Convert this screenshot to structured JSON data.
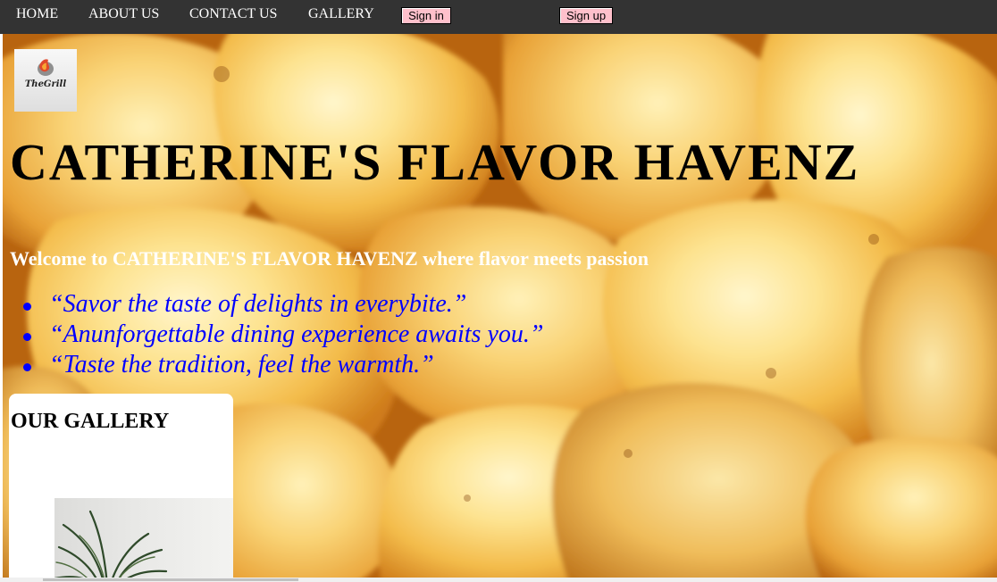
{
  "nav": {
    "links": [
      "HOME",
      "ABOUT US",
      "CONTACT US",
      "GALLERY"
    ],
    "signin_label": "Sign in",
    "signup_label": "Sign up"
  },
  "hero": {
    "title": "CATHERINE'S FLAVOR HAVENZ",
    "welcome": "Welcome to CATHERINE'S FLAVOR HAVENZ where flavor meets passion",
    "quotes": [
      "“Savor the taste of delights in everybite.”",
      "“Anunforgettable dining experience awaits you.”",
      "“Taste the tradition, feel the warmth.”"
    ]
  },
  "gallery": {
    "heading": "OUR GALLERY"
  },
  "colors": {
    "nav_bg": "#333333",
    "button_bg": "#ffc0cb",
    "quote_text": "#0000ff",
    "welcome_text": "#ffffff"
  },
  "icons": {
    "logo": "the-grill-logo",
    "photo": "potted-plant-photo"
  }
}
